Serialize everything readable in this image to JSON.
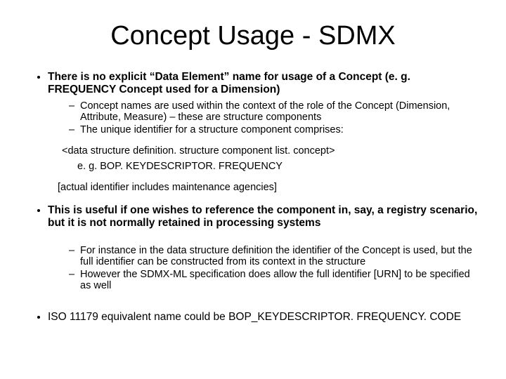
{
  "title": "Concept Usage - SDMX",
  "bullets": {
    "b1": {
      "main": "There is no explicit “Data Element” name for usage of a Concept (e. g. FREQUENCY Concept used for a Dimension)",
      "sub1": "Concept names are used within the context of the role of the Concept (Dimension, Attribute, Measure) – these are structure components",
      "sub2": "The unique identifier for a structure component comprises:",
      "inset1": "<data structure definition. structure component list. concept>",
      "inset2": "e. g. BOP. KEYDESCRIPTOR. FREQUENCY",
      "inset3": "[actual identifier includes maintenance agencies]"
    },
    "b2": {
      "main": "This is useful if one wishes to reference the component in, say, a registry scenario, but it is not normally retained in processing systems",
      "sub1": "For instance in the data structure definition the identifier of the Concept is used, but the full identifier can be constructed from its context in the structure",
      "sub2": "However the SDMX-ML specification does allow the full identifier [URN] to be specified as well"
    },
    "b3": {
      "main": "ISO 11179 equivalent name could be BOP_KEYDESCRIPTOR. FREQUENCY. CODE"
    }
  }
}
